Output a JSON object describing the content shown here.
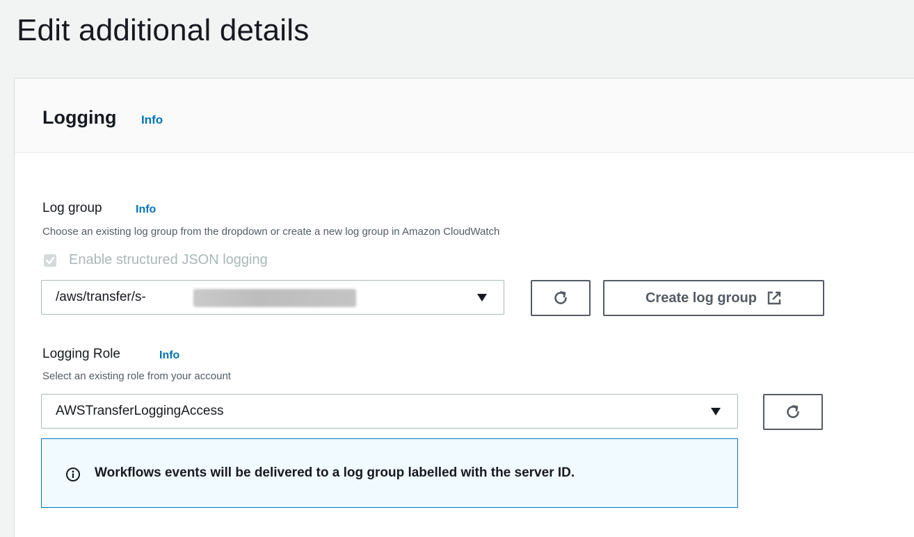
{
  "page": {
    "title": "Edit additional details"
  },
  "logging_section": {
    "title": "Logging",
    "info_label": "Info",
    "log_group": {
      "label": "Log group",
      "info_label": "Info",
      "description": "Choose an existing log group from the dropdown or create a new log group in Amazon CloudWatch",
      "structured_json_checkbox": {
        "label": "Enable structured JSON logging",
        "checked": true,
        "disabled": true
      },
      "selected_value": "/aws/transfer/s-",
      "refresh_icon": "refresh-icon",
      "create_button_label": "Create log group",
      "create_button_icon": "external-link-icon"
    },
    "logging_role": {
      "label": "Logging Role",
      "info_label": "Info",
      "description": "Select an existing role from your account",
      "selected_value": "AWSTransferLoggingAccess",
      "refresh_icon": "refresh-icon"
    },
    "alert": {
      "icon": "info-circle-icon",
      "message": "Workflows events will be delivered to a log group labelled with the server ID."
    }
  },
  "colors": {
    "link": "#0073bb",
    "alert_background": "#f1faff",
    "alert_border": "#0073bb",
    "page_background": "#f2f3f3"
  }
}
